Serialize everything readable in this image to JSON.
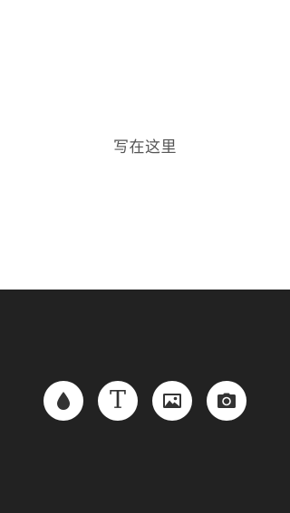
{
  "editor": {
    "placeholder": "写在这里"
  },
  "toolbar": {
    "buttons": [
      {
        "name": "color",
        "icon": "ink-drop-icon"
      },
      {
        "name": "text",
        "icon": "text-style-icon",
        "glyph": "T"
      },
      {
        "name": "image",
        "icon": "image-icon"
      },
      {
        "name": "camera",
        "icon": "camera-icon"
      }
    ]
  },
  "colors": {
    "canvas": "#ffffff",
    "toolbar": "#222222",
    "button": "#ffffff",
    "icon": "#333333",
    "placeholder_text": "#555555"
  }
}
